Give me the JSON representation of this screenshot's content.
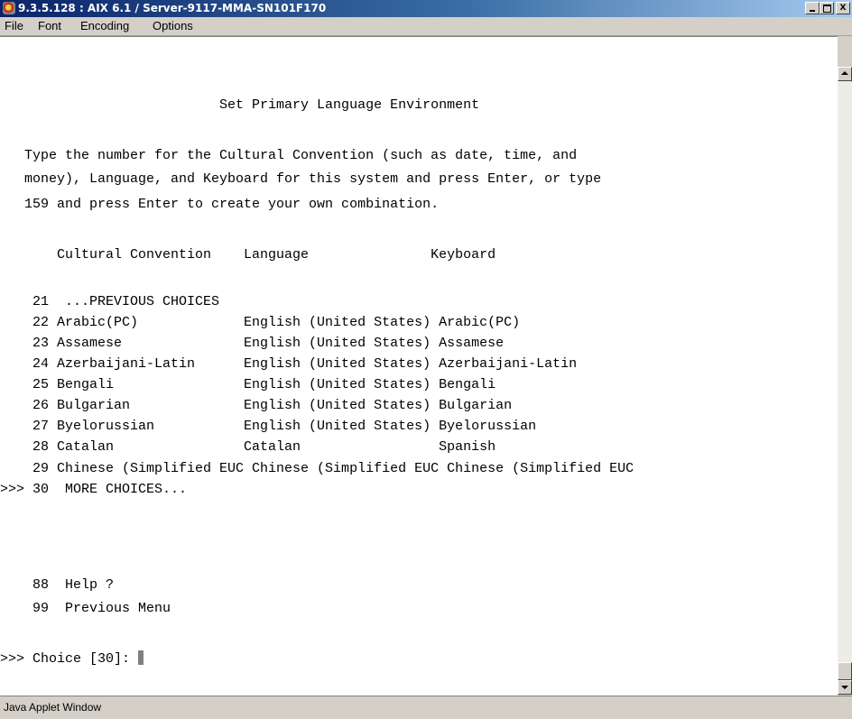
{
  "window": {
    "title": "9.3.5.128 : AIX 6.1 / Server-9117-MMA-SN101F170",
    "minimize": "_",
    "maximize": "□",
    "close": "X"
  },
  "menu": {
    "items": [
      "File",
      "Font",
      "Encoding",
      "Options"
    ]
  },
  "terminal": {
    "lines": [
      "",
      "",
      "                           Set Primary Language Environment",
      "",
      "   Type the number for the Cultural Convention (such as date, time, and",
      "   money), Language, and Keyboard for this system and press Enter, or type",
      "   159 and press Enter to create your own combination.",
      "",
      "       Cultural Convention    Language               Keyboard",
      "",
      "    21  ...PREVIOUS CHOICES",
      "    22 Arabic(PC)             English (United States) Arabic(PC)",
      "    23 Assamese               English (United States) Assamese",
      "    24 Azerbaijani-Latin      English (United States) Azerbaijani-Latin",
      "    25 Bengali                English (United States) Bengali",
      "    26 Bulgarian              English (United States) Bulgarian",
      "    27 Byelorussian           English (United States) Byelorussian",
      "    28 Catalan                Catalan                 Spanish",
      "    29 Chinese (Simplified EUC Chinese (Simplified EUC Chinese (Simplified EUC",
      ">>> 30  MORE CHOICES...",
      "",
      "",
      "",
      "    88  Help ?",
      "    99  Previous Menu",
      "",
      ">>> Choice [30]: "
    ]
  },
  "status": {
    "text": "Java Applet Window"
  }
}
